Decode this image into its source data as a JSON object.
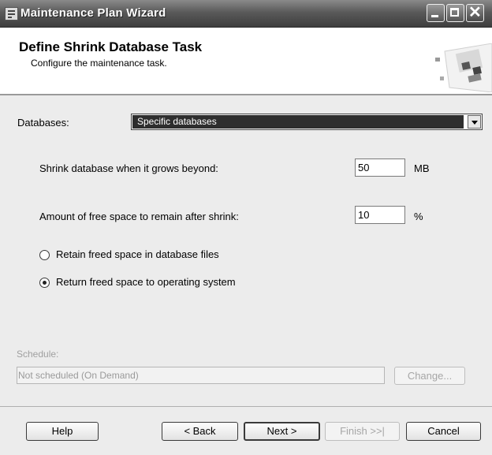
{
  "window": {
    "title": "Maintenance Plan Wizard",
    "icons": [
      "app-icon",
      "minimize-icon",
      "maximize-icon",
      "close-icon"
    ]
  },
  "header": {
    "title": "Define Shrink Database Task",
    "subtitle": "Configure the maintenance task."
  },
  "form": {
    "databases_label": "Databases:",
    "databases_value": "Specific databases",
    "shrink_label": "Shrink database when it grows beyond:",
    "shrink_value": "50",
    "shrink_unit": "MB",
    "free_space_label": "Amount of free space to remain after shrink:",
    "free_space_value": "10",
    "free_space_unit": "%",
    "options": [
      {
        "label": "Retain freed space in database files",
        "selected": false
      },
      {
        "label": "Return freed space to operating system",
        "selected": true
      }
    ]
  },
  "schedule": {
    "label": "Schedule:",
    "value": "Not scheduled (On Demand)",
    "change_label": "Change..."
  },
  "buttons": {
    "help": "Help",
    "back": "< Back",
    "next": "Next >",
    "finish": "Finish >>|",
    "cancel": "Cancel"
  },
  "colors": {
    "title_bar": "#5a5a5a",
    "dialog_bg": "#ececec",
    "selection": "#2e2e2e"
  }
}
